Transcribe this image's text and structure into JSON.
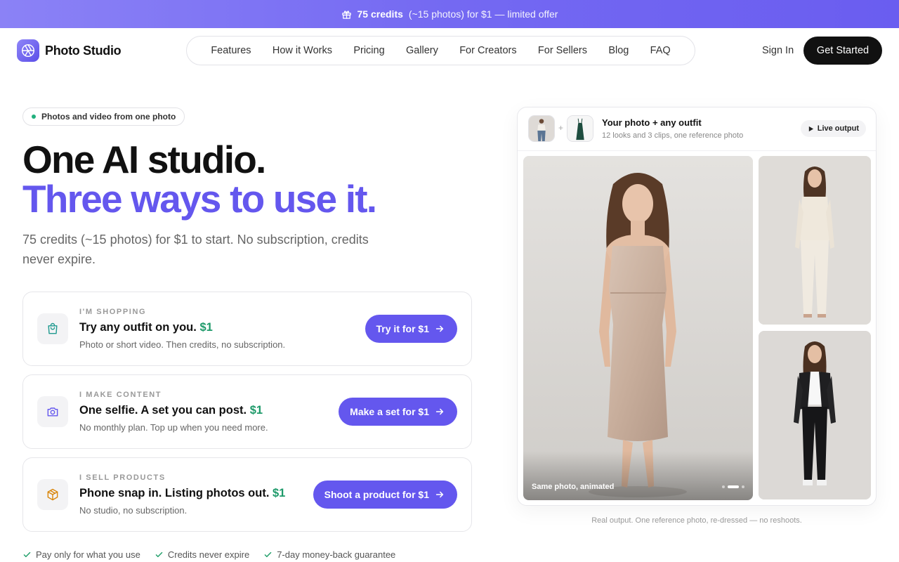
{
  "promo": {
    "highlight": "75 credits",
    "rest": "(~15 photos) for $1 — limited offer",
    "icon": "gift-icon"
  },
  "header": {
    "brand": "Photo Studio",
    "nav": [
      "Features",
      "How it Works",
      "Pricing",
      "Gallery",
      "For Creators",
      "For Sellers",
      "Blog",
      "FAQ"
    ],
    "sign_in": "Sign In",
    "get_started": "Get Started"
  },
  "hero": {
    "pill": "Photos and video from one photo",
    "headline_1": "One AI studio.",
    "headline_2": "Three ways to use it.",
    "subtitle": "75 credits (~15 photos) for $1 to start. No subscription, credits never expire.",
    "accent_color": "#6457ee",
    "price_color": "#1e9a6a"
  },
  "options": [
    {
      "kicker": "I'M SHOPPING",
      "title": "Try any outfit on you.",
      "price": "$1",
      "desc": "Photo or short video. Then credits, no subscription.",
      "cta": "Try it for $1",
      "icon": "shopping-bag-icon"
    },
    {
      "kicker": "I MAKE CONTENT",
      "title": "One selfie. A set you can post.",
      "price": "$1",
      "desc": "No monthly plan. Top up when you need more.",
      "cta": "Make a set for $1",
      "icon": "camera-icon"
    },
    {
      "kicker": "I SELL PRODUCTS",
      "title": "Phone snap in. Listing photos out.",
      "price": "$1",
      "desc": "No studio, no subscription.",
      "cta": "Shoot a product for $1",
      "icon": "package-icon"
    }
  ],
  "trust": [
    "Pay only for what you use",
    "Credits never expire",
    "7-day money-back guarantee"
  ],
  "preview": {
    "plus": "+",
    "title": "Your photo + any outfit",
    "subtitle": "12 looks and 3 clips, one reference photo",
    "live": "Live output",
    "main_caption": "Same photo, animated",
    "footnote": "Real output. One reference photo, re-dressed — no reshoots."
  }
}
